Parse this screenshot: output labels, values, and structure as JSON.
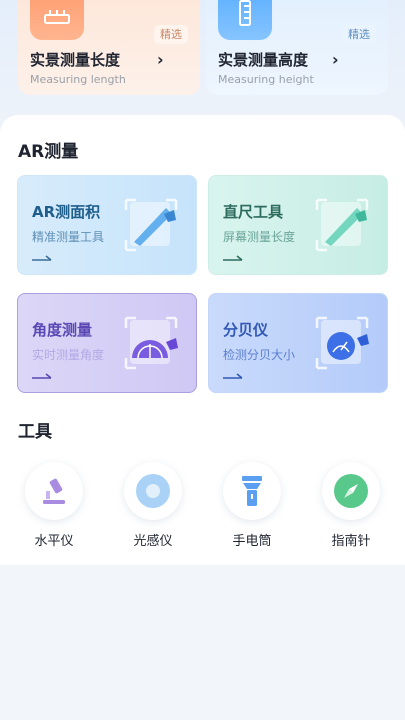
{
  "features": [
    {
      "title": "实景测量长度",
      "subtitle": "Measuring length",
      "badge": "精选",
      "chevron": "›",
      "icon": "ruler-horizontal-icon",
      "color": "#ff9a6e"
    },
    {
      "title": "实景测量高度",
      "subtitle": "Measuring height",
      "badge": "精选",
      "chevron": "›",
      "icon": "ruler-vertical-icon",
      "color": "#5aaeff"
    }
  ],
  "ar_section": {
    "title": "AR测量",
    "cards": [
      {
        "title": "AR测面积",
        "subtitle": "精准测量工具",
        "icon": "area-measure-icon",
        "color": "#4ea3ea"
      },
      {
        "title": "直尺工具",
        "subtitle": "屏幕测量长度",
        "icon": "straight-ruler-icon",
        "color": "#3fc4a8"
      },
      {
        "title": "角度测量",
        "subtitle": "实时测量角度",
        "icon": "protractor-icon",
        "color": "#7a5ce0"
      },
      {
        "title": "分贝仪",
        "subtitle": "检测分贝大小",
        "icon": "decibel-meter-icon",
        "color": "#3d6fe6"
      }
    ]
  },
  "tools_section": {
    "title": "工具",
    "items": [
      {
        "label": "水平仪",
        "icon": "microscope-level-icon",
        "color": "#a98be0"
      },
      {
        "label": "光感仪",
        "icon": "light-sensor-icon",
        "color": "#7fb8ee"
      },
      {
        "label": "手电筒",
        "icon": "flashlight-icon",
        "color": "#5b9ff0"
      },
      {
        "label": "指南针",
        "icon": "compass-icon",
        "color": "#58c98a"
      }
    ]
  }
}
